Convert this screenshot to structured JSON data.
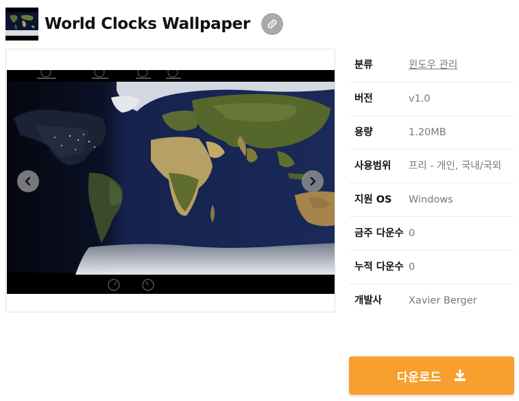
{
  "header": {
    "title": "World Clocks Wallpaper",
    "thumb_alt": "app-thumbnail"
  },
  "gallery": {
    "prev_icon": "chevron-left-icon",
    "next_icon": "chevron-right-icon"
  },
  "info": [
    {
      "label": "분류",
      "value": "윈도우 관리",
      "is_link": true
    },
    {
      "label": "버전",
      "value": "v1.0"
    },
    {
      "label": "용량",
      "value": "1.20MB"
    },
    {
      "label": "사용범위",
      "value": "프리 - 개인, 국내/국외"
    },
    {
      "label": "지원 OS",
      "value": "Windows"
    },
    {
      "label": "금주 다운수",
      "value": "0"
    },
    {
      "label": "누적 다운수",
      "value": "0"
    },
    {
      "label": "개발사",
      "value": "Xavier Berger"
    }
  ],
  "download": {
    "label": "다운로드",
    "icon": "download-icon"
  },
  "colors": {
    "accent": "#f7a02f",
    "ocean": "#0d1a3f",
    "land": "#5a6a2e"
  }
}
